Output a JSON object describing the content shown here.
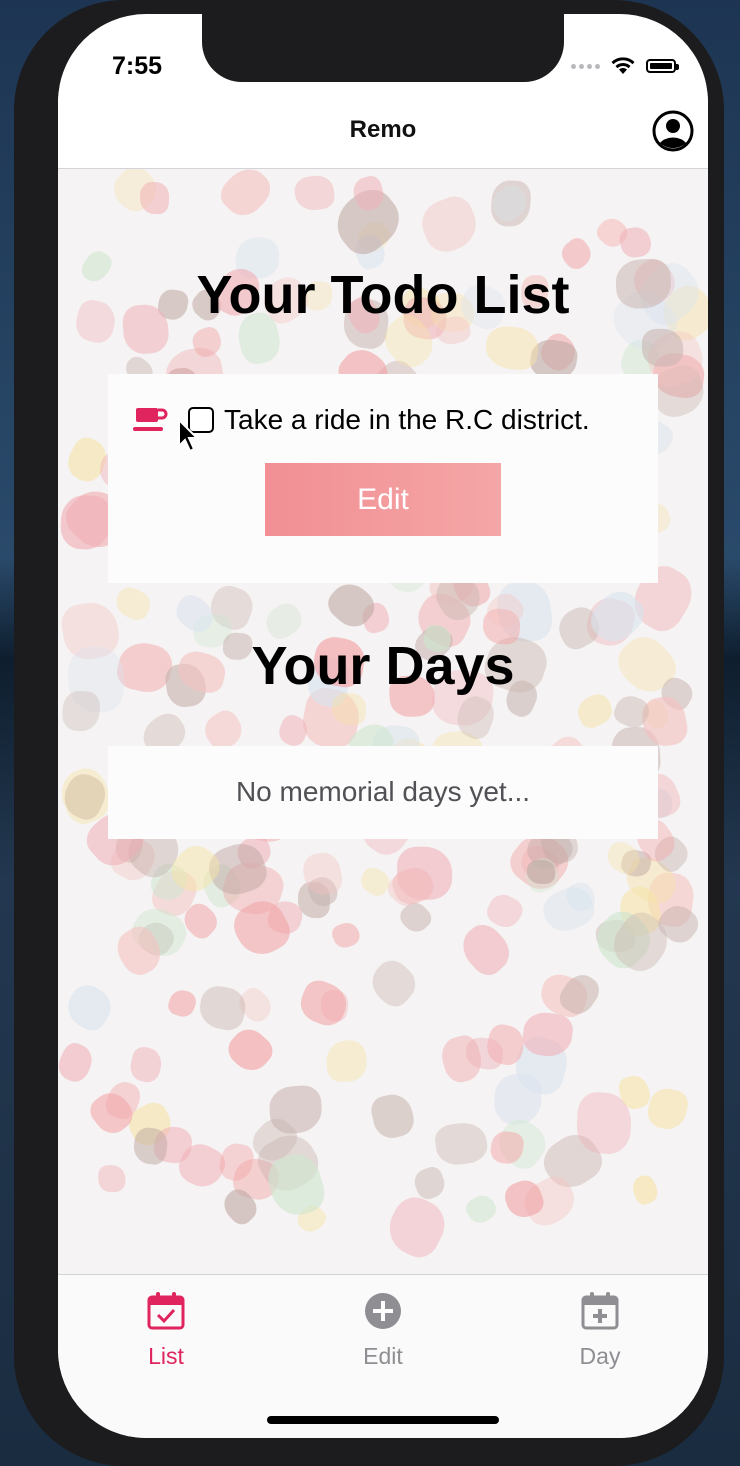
{
  "status_bar": {
    "time": "7:55"
  },
  "navbar": {
    "title": "Remo",
    "profile_icon": "user-circle-icon"
  },
  "todo_section": {
    "title": "Your Todo List",
    "items": [
      {
        "icon": "coffee-cup-icon",
        "text": "Take a ride in the R.C district.",
        "checked": false
      }
    ],
    "edit_label": "Edit"
  },
  "days_section": {
    "title": "Your Days",
    "empty_message": "No memorial days yet..."
  },
  "tabbar": {
    "tabs": [
      {
        "label": "List",
        "icon": "calendar-check-icon",
        "active": true
      },
      {
        "label": "Edit",
        "icon": "plus-circle-icon",
        "active": false
      },
      {
        "label": "Day",
        "icon": "calendar-plus-icon",
        "active": false
      }
    ]
  },
  "colors": {
    "accent": "#e0245e",
    "edit_button": "#f18f94",
    "tab_inactive": "#8e8e93"
  }
}
